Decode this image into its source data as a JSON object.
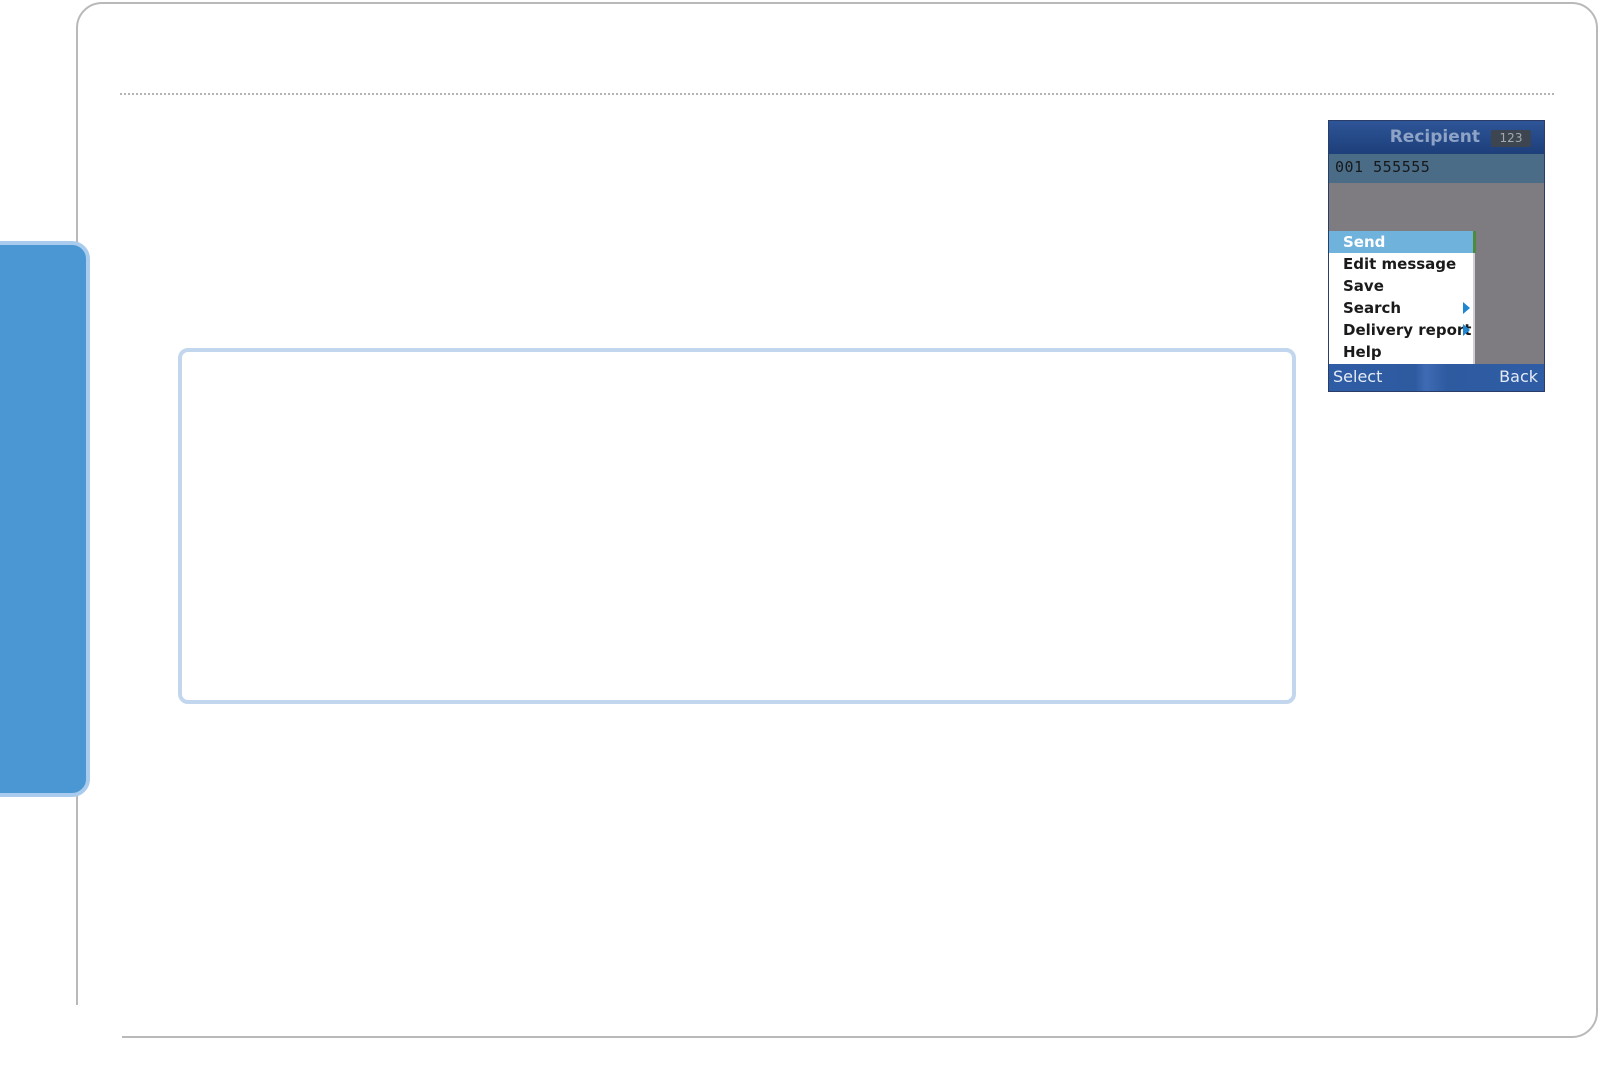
{
  "phone": {
    "title": "Recipient",
    "input_mode": "123",
    "recipient_number": "001 555555",
    "menu": [
      {
        "label": "Send",
        "selected": true,
        "has_submenu": false
      },
      {
        "label": "Edit message",
        "selected": false,
        "has_submenu": false
      },
      {
        "label": "Save",
        "selected": false,
        "has_submenu": false
      },
      {
        "label": "Search",
        "selected": false,
        "has_submenu": true
      },
      {
        "label": "Delivery report",
        "selected": false,
        "has_submenu": true
      },
      {
        "label": "Help",
        "selected": false,
        "has_submenu": false
      }
    ],
    "softkeys": {
      "left": "Select",
      "right": "Back"
    }
  },
  "colors": {
    "side_tab": "#4a97d3",
    "note_border": "#c2d6ee",
    "menu_highlight": "#6fb2dc",
    "softkey_bar": "#2f5da5"
  }
}
